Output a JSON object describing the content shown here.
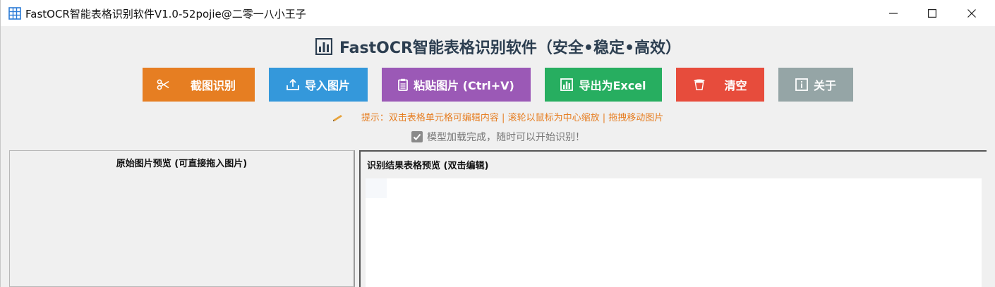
{
  "window": {
    "title": "FastOCR智能表格识别软件V1.0-52pojie@二零一八小王子"
  },
  "header": {
    "title": "FastOCR智能表格识别软件（安全•稳定•高效）"
  },
  "toolbar": {
    "capture_label": "截图识别",
    "import_label": "导入图片",
    "paste_label": "粘贴图片 (Ctrl+V)",
    "export_label": "导出为Excel",
    "clear_label": "清空",
    "about_label": "关于"
  },
  "hint": {
    "text": "提示：双击表格单元格可编辑内容 | 滚轮以鼠标为中心缩放 | 拖拽移动图片"
  },
  "status": {
    "text": "模型加载完成，随时可以开始识别！"
  },
  "panels": {
    "left_title": "原始图片预览 (可直接拖入图片)",
    "right_title": "识别结果表格预览 (双击编辑)"
  },
  "colors": {
    "capture": "#e67e22",
    "import": "#3498db",
    "paste": "#9b59b6",
    "export": "#27ae60",
    "clear": "#e74c3c",
    "about": "#95a5a6",
    "title_text": "#2c3e50",
    "hint_text": "#e67e22"
  },
  "icons": {
    "app": "table-icon",
    "title": "bar-chart-icon",
    "capture": "scissors-icon",
    "import": "upload-tray-icon",
    "paste": "clipboard-icon",
    "export": "bar-chart-icon",
    "clear": "trash-icon",
    "about": "info-icon",
    "hint": "pencil-icon",
    "status": "checkbox-checked-icon"
  }
}
